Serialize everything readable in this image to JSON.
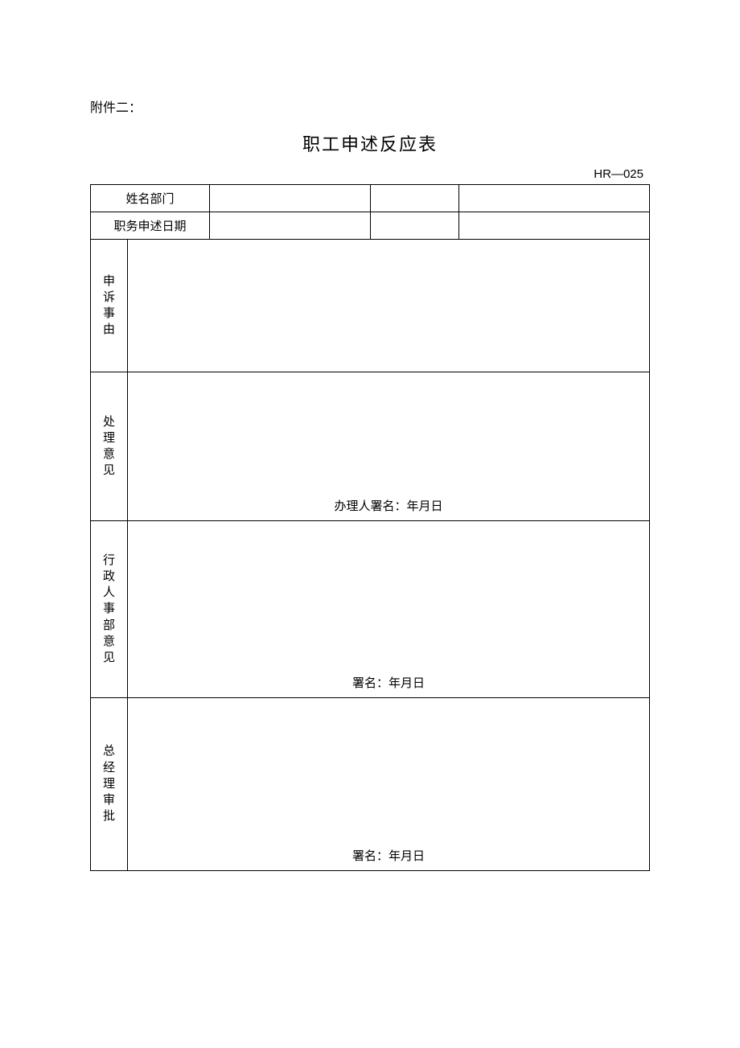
{
  "attachment_label": "附件二：",
  "title": "职工申述反应表",
  "form_code": "HR—025",
  "header_rows": {
    "row1_label": "姓名部门",
    "row2_label": "职务申述日期"
  },
  "sections": {
    "reason": {
      "label_chars": [
        "申",
        "诉",
        "事",
        "由"
      ]
    },
    "opinion": {
      "label_chars": [
        "处",
        "理",
        "意",
        "见"
      ],
      "signature": "办理人署名：年月日"
    },
    "hr": {
      "label_chars": [
        "行",
        "政",
        "人",
        "事",
        "部",
        "意",
        "见"
      ],
      "signature": "署名：年月日"
    },
    "gm": {
      "label_chars": [
        "总",
        "经",
        "理",
        "审",
        "批"
      ],
      "signature": "署名：年月日"
    }
  }
}
